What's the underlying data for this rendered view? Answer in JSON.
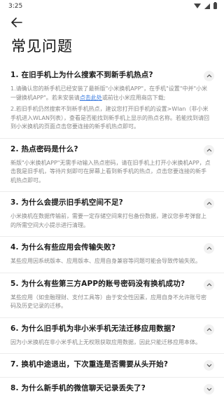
{
  "status_bar": {
    "time": "3:25"
  },
  "page": {
    "title": "常见问题"
  },
  "faqs": [
    {
      "q": "1. 在旧手机上为什么搜索不到新手机热点?",
      "a1_pre": "1.请确认您的新手机已经安装了最新版\"小米换机APP\"，在手机\"设置\"中并\"小米一键换机APP\"。若未安装请",
      "a1_link": "点击此处",
      "a1_post": "或前往小米应用商店下载;",
      "a2": "2.若旧手机仍然搜索不到新手机热点，建议您打开旧手机的设置>Wlan（非小米手机进入WLAN列表），查看是否能找到新手机上显示的热点名称。若能找到请回到小米换机的页面点击您要连接的新手机热点即可。"
    },
    {
      "q": "2. 热点密码是什么?",
      "a": "新版\"小米换机APP\"无需手动输入热点密码，请在旧手机上打开小米换机APP，点击我是旧手机，等待片刻即可在屏幕上看到新手机的热点，点击您要连接的新手机热点即可。"
    },
    {
      "q": "3. 为什么会提示旧手机空间不足?",
      "a": "小米换机在数据传输前，需要一定存储空间来打包备份数据，建议您参考弹窗上的所需空间大小提示进行清理。"
    },
    {
      "q": "4. 为什么有些应用会传输失败?",
      "a": "某些应用因系统版本、应用版本、应用自身兼容等问题可能会导致传输失败。"
    },
    {
      "q": "5. 为什么有些第三方APP的账号密码没有换机成功?",
      "a": "某些应用（如金融理财、支付工具等）由于安全性因素，应用自身不允许账号密码及历史记录的迁移。"
    },
    {
      "q": "6. 为什么旧手机为非小米手机无法迁移应用数据?",
      "a": "因为小米换机在非小米手机上无权限获取应用数据，因此只能迁移应用本体。"
    },
    {
      "q": "7. 换机中途退出，下次重连是否需要从头开始?"
    },
    {
      "q": "8. 为什么新手机的微信聊天记录丢失了?"
    }
  ]
}
